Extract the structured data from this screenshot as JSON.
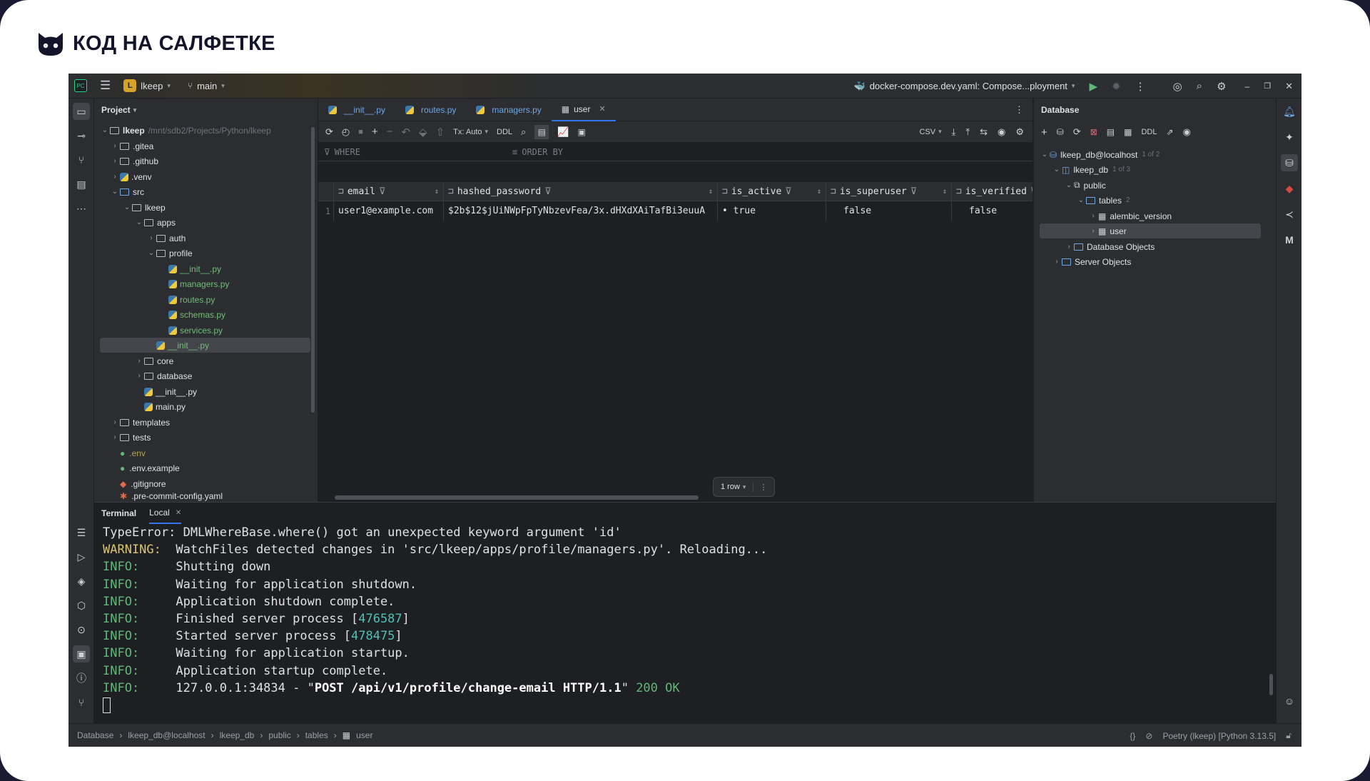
{
  "brand": {
    "text": "КОД НА САЛФЕТКЕ"
  },
  "titlebar": {
    "project_letter": "L",
    "project_name": "lkeep",
    "branch": "main",
    "run_config": "docker-compose.dev.yaml: Compose...ployment"
  },
  "project_panel": {
    "title": "Project",
    "root_name": "lkeep",
    "root_path": "/mnt/sdb2/Projects/Python/lkeep",
    "items": [
      {
        "label": ".gitea"
      },
      {
        "label": ".github"
      },
      {
        "label": ".venv"
      },
      {
        "label": "src"
      },
      {
        "label": "lkeep"
      },
      {
        "label": "apps"
      },
      {
        "label": "auth"
      },
      {
        "label": "profile"
      },
      {
        "label": "__init__.py"
      },
      {
        "label": "managers.py"
      },
      {
        "label": "routes.py"
      },
      {
        "label": "schemas.py"
      },
      {
        "label": "services.py"
      },
      {
        "label": "__init__.py"
      },
      {
        "label": "core"
      },
      {
        "label": "database"
      },
      {
        "label": "__init__.py"
      },
      {
        "label": "main.py"
      },
      {
        "label": "templates"
      },
      {
        "label": "tests"
      },
      {
        "label": ".env"
      },
      {
        "label": ".env.example"
      },
      {
        "label": ".gitignore"
      },
      {
        "label": ".pre-commit-config.yaml"
      }
    ]
  },
  "editor": {
    "tabs": [
      {
        "label": "__init__.py"
      },
      {
        "label": "routes.py"
      },
      {
        "label": "managers.py"
      },
      {
        "label": "user"
      }
    ],
    "toolbar": {
      "tx": "Tx: Auto",
      "ddl": "DDL",
      "export": "CSV"
    },
    "filter": {
      "where": "WHERE",
      "order_by": "ORDER BY"
    },
    "columns": [
      "email",
      "hashed_password",
      "is_active",
      "is_superuser",
      "is_verified"
    ],
    "rows": [
      {
        "num": "1",
        "email": "user1@example.com",
        "hashed_password": "$2b$12$jUiNWpFpTyNbzevFea/3x.dHXdXAiTafBi3euuA",
        "is_active": "• true",
        "is_superuser": "false",
        "is_verified": "false"
      }
    ],
    "row_count": "1 row"
  },
  "db_panel": {
    "title": "Database",
    "ddl": "DDL",
    "tree": {
      "connection": "lkeep_db@localhost",
      "connection_count": "1 of 2",
      "database": "lkeep_db",
      "database_count": "1 of 3",
      "schema": "public",
      "tables": "tables",
      "tables_count": "2",
      "table1": "alembic_version",
      "table2": "user",
      "db_objects": "Database Objects",
      "server_objects": "Server Objects"
    }
  },
  "terminal": {
    "tab_title": "Terminal",
    "tab_local": "Local",
    "lines": {
      "l1": "TypeError: DMLWhereBase.where() got an unexpected keyword argument 'id'",
      "l2_level": "WARNING:",
      "l2_msg": "  WatchFiles detected changes in 'src/lkeep/apps/profile/managers.py'. Reloading...",
      "l3_level": "INFO:",
      "l3_msg": "     Shutting down",
      "l4_level": "INFO:",
      "l4_msg": "     Waiting for application shutdown.",
      "l5_level": "INFO:",
      "l5_msg": "     Application shutdown complete.",
      "l6_level": "INFO:",
      "l6_msg": "     Finished server process [",
      "l6_pid": "476587",
      "l6_end": "]",
      "l7_level": "INFO:",
      "l7_msg": "     Started server process [",
      "l7_pid": "478475",
      "l7_end": "]",
      "l8_level": "INFO:",
      "l8_msg": "     Waiting for application startup.",
      "l9_level": "INFO:",
      "l9_msg": "     Application startup complete.",
      "l10_level": "INFO:",
      "l10_msg": "     127.0.0.1:34834 - \"",
      "l10_req": "POST /api/v1/profile/change-email HTTP/1.1",
      "l10_q": "\"",
      "l10_status": " 200 OK"
    }
  },
  "statusbar": {
    "crumbs": [
      "Database",
      "lkeep_db@localhost",
      "lkeep_db",
      "public",
      "tables",
      "user"
    ],
    "braces": "{}",
    "interpreter": "Poetry (lkeep) [Python 3.13.5]"
  },
  "colors": {
    "accent": "#3574f0",
    "ide_bg": "#1e1f22",
    "panel_bg": "#2b2d30",
    "info_green": "#5fb878",
    "warning_yellow": "#d9c46f",
    "pid_teal": "#4fc1b4"
  }
}
